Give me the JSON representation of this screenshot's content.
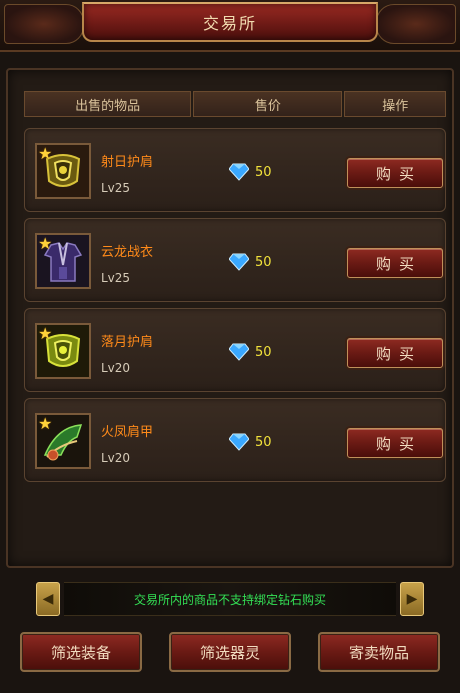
{
  "window": {
    "title": "交易所"
  },
  "table": {
    "headers": [
      "出售的物品",
      "售价",
      "操作"
    ]
  },
  "items": [
    {
      "name": "射日护肩",
      "level": "Lv25",
      "price": "50",
      "buy_label": "购买",
      "icon": "pauldron-icon"
    },
    {
      "name": "云龙战衣",
      "level": "Lv25",
      "price": "50",
      "buy_label": "购买",
      "icon": "robe-icon"
    },
    {
      "name": "落月护肩",
      "level": "Lv20",
      "price": "50",
      "buy_label": "购买",
      "icon": "pauldron-icon"
    },
    {
      "name": "火凤肩甲",
      "level": "Lv20",
      "price": "50",
      "buy_label": "购买",
      "icon": "shoulder-armor-icon"
    }
  ],
  "notice": "交易所内的商品不支持绑定钻石购买",
  "bottom_buttons": [
    "筛选装备",
    "筛选器灵",
    "寄卖物品"
  ],
  "colors": {
    "item_name": "#ff8a1a",
    "price": "#f2e23a",
    "notice": "#33e055",
    "accent_red": "#8e2a22"
  }
}
